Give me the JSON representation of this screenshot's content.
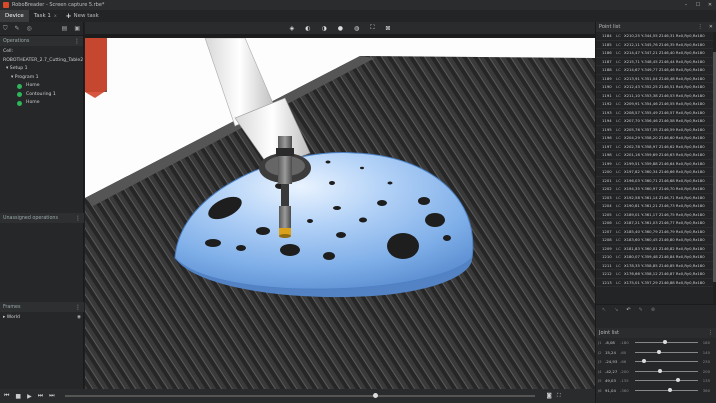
{
  "titlebar": {
    "app_name": "RoboDK",
    "title": "RoboBreader - Screen capture 5.rbe*"
  },
  "tabs": [
    {
      "label": "Device"
    },
    {
      "label": "Task 1",
      "close": "x"
    }
  ],
  "new_tab": {
    "plus": "+",
    "label": "New task"
  },
  "left_panel": {
    "operations_header": "Operations",
    "cell_label": "Cell: ROBOTHEATER_2.7_Cutting_Table2",
    "setup": "Setup 1",
    "program": "Program 1",
    "items": [
      {
        "label": "Home",
        "color": "#2fb65a"
      },
      {
        "label": "Contouring 1",
        "color": "#2fb65a"
      },
      {
        "label": "Home",
        "color": "#2fb65a"
      }
    ],
    "unassigned_header": "Unassigned operations",
    "frames_header": "Frames",
    "frames_world": "World"
  },
  "point_list": {
    "header": "Point list",
    "rows": [
      {
        "n": "1184",
        "t": "LC",
        "v": "X210,25 Y-344,55 Z146,31 Rx0,Ry0,Rz180"
      },
      {
        "n": "1185",
        "t": "LC",
        "v": "X212,11 Y-345,76 Z146,35 Rx0,Ry0,Rz180"
      },
      {
        "n": "1186",
        "t": "LC",
        "v": "X214,47 Y-347,21 Z146,40 Rx0,Ry0,Rz180"
      },
      {
        "n": "1187",
        "t": "LC",
        "v": "X215,71 Y-348,45 Z146,44 Rx0,Ry0,Rz180"
      },
      {
        "n": "1188",
        "t": "LC",
        "v": "X214,67 Y-349,77 Z146,46 Rx0,Ry0,Rz180"
      },
      {
        "n": "1189",
        "t": "LC",
        "v": "X213,91 Y-351,04 Z146,48 Rx0,Ry0,Rz180"
      },
      {
        "n": "1190",
        "t": "LC",
        "v": "X212,43 Y-352,25 Z146,51 Rx0,Ry0,Rz180"
      },
      {
        "n": "1191",
        "t": "LC",
        "v": "X211,10 Y-353,38 Z146,53 Rx0,Ry0,Rz180"
      },
      {
        "n": "1192",
        "t": "LC",
        "v": "X209,91 Y-354,46 Z146,55 Rx0,Ry0,Rz180"
      },
      {
        "n": "1193",
        "t": "LC",
        "v": "X208,57 Y-355,49 Z146,57 Rx0,Ry0,Rz180"
      },
      {
        "n": "1194",
        "t": "LC",
        "v": "X207,70 Y-356,46 Z146,58 Rx0,Ry0,Rz180"
      },
      {
        "n": "1195",
        "t": "LC",
        "v": "X205,76 Y-357,35 Z146,59 Rx0,Ry0,Rz180"
      },
      {
        "n": "1196",
        "t": "LC",
        "v": "X204,29 Y-358,20 Z146,60 Rx0,Ry0,Rz180"
      },
      {
        "n": "1197",
        "t": "LC",
        "v": "X202,78 Y-358,97 Z146,62 Rx0,Ry0,Rz180"
      },
      {
        "n": "1198",
        "t": "LC",
        "v": "X201,16 Y-359,69 Z146,63 Rx0,Ry0,Rz180"
      },
      {
        "n": "1199",
        "t": "LC",
        "v": "X199,51 Y-359,88 Z146,64 Rx0,Ry0,Rz180"
      },
      {
        "n": "1200",
        "t": "LC",
        "v": "X197,82 Y-360,34 Z146,66 Rx0,Ry0,Rz180"
      },
      {
        "n": "1201",
        "t": "LC",
        "v": "X196,03 Y-360,71 Z146,68 Rx0,Ry0,Rz180"
      },
      {
        "n": "1202",
        "t": "LC",
        "v": "X194,35 Y-360,97 Z146,70 Rx0,Ry0,Rz180"
      },
      {
        "n": "1203",
        "t": "LC",
        "v": "X192,58 Y-361,14 Z146,71 Rx0,Ry0,Rz180"
      },
      {
        "n": "1204",
        "t": "LC",
        "v": "X190,81 Y-361,21 Z146,73 Rx0,Ry0,Rz180"
      },
      {
        "n": "1205",
        "t": "LC",
        "v": "X189,01 Y-361,17 Z146,75 Rx0,Ry0,Rz180"
      },
      {
        "n": "1206",
        "t": "LC",
        "v": "X187,21 Y-361,03 Z146,77 Rx0,Ry0,Rz180"
      },
      {
        "n": "1207",
        "t": "LC",
        "v": "X185,40 Y-360,79 Z146,79 Rx0,Ry0,Rz180"
      },
      {
        "n": "1208",
        "t": "LC",
        "v": "X183,60 Y-360,45 Z146,80 Rx0,Ry0,Rz180"
      },
      {
        "n": "1209",
        "t": "LC",
        "v": "X181,83 Y-360,01 Z146,82 Rx0,Ry0,Rz180"
      },
      {
        "n": "1210",
        "t": "LC",
        "v": "X180,07 Y-359,48 Z146,84 Rx0,Ry0,Rz180"
      },
      {
        "n": "1211",
        "t": "LC",
        "v": "X178,35 Y-358,85 Z146,85 Rx0,Ry0,Rz180"
      },
      {
        "n": "1212",
        "t": "LC",
        "v": "X176,66 Y-358,12 Z146,87 Rx0,Ry0,Rz180"
      },
      {
        "n": "1213",
        "t": "LC",
        "v": "X175,01 Y-357,29 Z146,88 Rx0,Ry0,Rz180"
      }
    ]
  },
  "joint_list": {
    "header": "Joint list",
    "joints": [
      {
        "name": "J1",
        "value": "-6,08",
        "min": "-180",
        "max": "180",
        "level": 0.48
      },
      {
        "name": "J2",
        "value": "15,24",
        "min": "-60",
        "max": "140",
        "level": 0.38
      },
      {
        "name": "J3",
        "value": "-24,93",
        "min": "-66",
        "max": "230",
        "level": 0.14
      },
      {
        "name": "J4",
        "value": "-42,27",
        "min": "-200",
        "max": "200",
        "level": 0.4
      },
      {
        "name": "J5",
        "value": "49,03",
        "min": "-135",
        "max": "135",
        "level": 0.68
      },
      {
        "name": "J6",
        "value": "91,04",
        "min": "-360",
        "max": "360",
        "level": 0.56
      }
    ]
  },
  "playback": {
    "progress": 0.66
  }
}
